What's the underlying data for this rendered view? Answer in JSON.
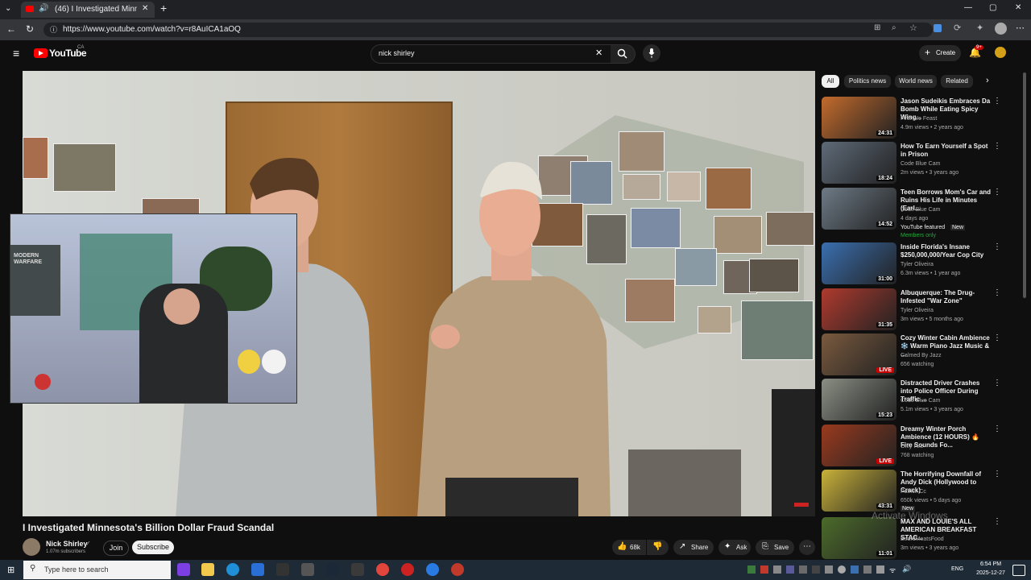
{
  "browser": {
    "tab_title": "(46) I Investigated Minnesota",
    "url": "https://www.youtube.com/watch?v=r8AuICA1aOQ"
  },
  "youtube": {
    "logo_text": "YouTube",
    "region": "CA",
    "search_value": "nick shirley",
    "create_label": "Create",
    "notif_count": "9+"
  },
  "video": {
    "title": "I Investigated Minnesota's Billion Dollar Fraud Scandal",
    "channel": "Nick Shirley",
    "subscribers": "1.07m subscribers",
    "join_label": "Join",
    "subscribe_label": "Subscribe",
    "likes": "68k",
    "share_label": "Share",
    "ask_label": "Ask",
    "save_label": "Save"
  },
  "chips": [
    "All",
    "Politics news",
    "World news",
    "Related"
  ],
  "recommendations": [
    {
      "title": "Jason Sudeikis Embraces Da Bomb While Eating Spicy Wing...",
      "channel": "First We Feast",
      "meta": "4.9m views • 2 years ago",
      "duration": "24:31",
      "thumb_color": "#c46b2c"
    },
    {
      "title": "How To Earn Yourself a Spot in Prison",
      "channel": "Code Blue Cam",
      "meta": "2m views • 3 years ago",
      "duration": "18:24",
      "thumb_color": "#5e6a78"
    },
    {
      "title": "Teen Borrows Mom's Car and Ruins His Life in Minutes (Earl...",
      "channel": "Code Blue Cam",
      "meta": "4 days ago",
      "badge1": "YouTube featured",
      "badge2": "New",
      "badge3": "Members only",
      "duration": "14:52",
      "thumb_color": "#6d7a86"
    },
    {
      "title": "Inside Florida's Insane $250,000,000/Year Cop City",
      "channel": "Tyler Oliveira",
      "meta": "6.3m views • 1 year ago",
      "duration": "31:00",
      "thumb_color": "#3a6fb0"
    },
    {
      "title": "Albuquerque: The Drug-Infested \"War Zone\"",
      "channel": "Tyler Oliveira",
      "meta": "3m views • 5 months ago",
      "duration": "31:35",
      "thumb_color": "#b03a2e"
    },
    {
      "title": "Cozy Winter Cabin Ambience ❄️ Warm Piano Jazz Music & ...",
      "channel": "Calmed By Jazz",
      "meta": "656 watching",
      "live": "LIVE",
      "thumb_color": "#7a5a3e"
    },
    {
      "title": "Distracted Driver Crashes into Police Officer During Traffic ...",
      "channel": "Code Blue Cam",
      "meta": "5.1m views • 3 years ago",
      "duration": "15:23",
      "thumb_color": "#8a8f84"
    },
    {
      "title": "Dreamy Winter Porch Ambience (12 HOURS) 🔥 Fire Sounds Fo...",
      "channel": "Only Fire",
      "meta": "768 watching",
      "live": "LIVE",
      "thumb_color": "#9a3a1e"
    },
    {
      "title": "The Horrifying Downfall of Andy Dick (Hollywood to Crack)",
      "channel": "Patrick Cc",
      "meta": "650k views • 5 days ago",
      "duration": "43:31",
      "badge2": "New",
      "thumb_color": "#c9b23a"
    },
    {
      "title": "MAX AND LOUIE'S ALL AMERICAN BREAKFAST STAC...",
      "channel": "BeardMeatsFood",
      "meta": "3m views • 3 years ago",
      "duration": "11:01",
      "thumb_color": "#4c6b2a"
    }
  ],
  "watermark": "Activate Windows",
  "taskbar": {
    "search_placeholder": "Type here to search",
    "lang": "ENG",
    "time": "6:54 PM",
    "date": "2025-12-27"
  },
  "pip": {
    "poster_text": "MODERN WARFARE"
  }
}
